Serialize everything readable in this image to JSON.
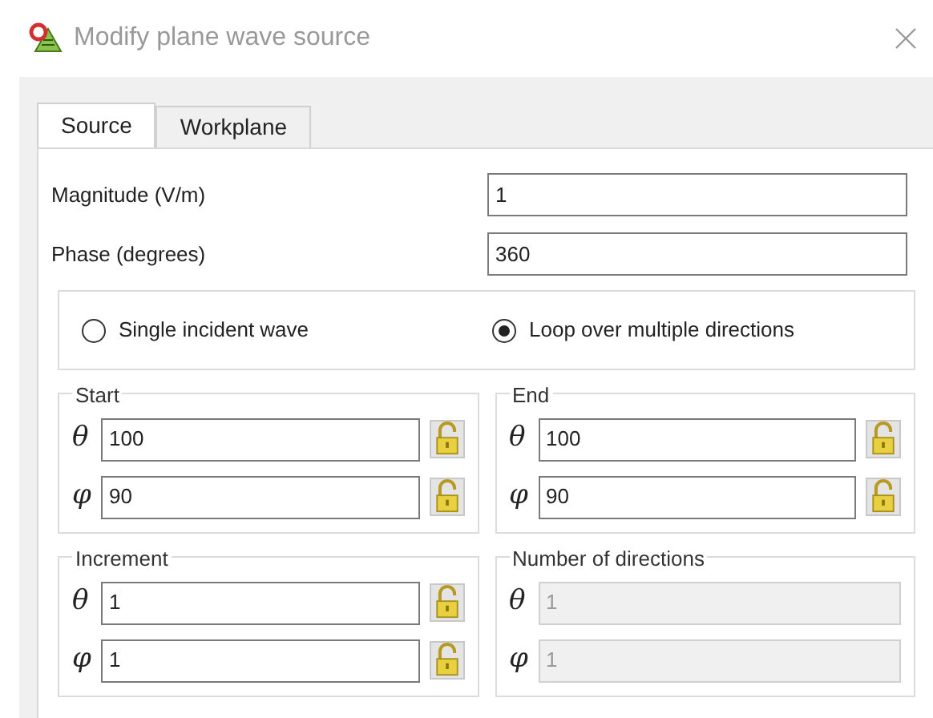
{
  "window": {
    "title": "Modify plane wave source"
  },
  "tabs": [
    {
      "label": "Source",
      "selected": true
    },
    {
      "label": "Workplane",
      "selected": false
    }
  ],
  "fields": [
    {
      "label": "Magnitude (V/m)",
      "value": "1"
    },
    {
      "label": "Phase (degrees)",
      "value": "360"
    }
  ],
  "mode": [
    {
      "label": "Single incident wave",
      "selected": false
    },
    {
      "label": "Loop over multiple directions",
      "selected": true
    }
  ],
  "groups": [
    {
      "title": "Start",
      "rows": [
        {
          "symbol": "θ",
          "value": "100",
          "disabled": false,
          "lock": true
        },
        {
          "symbol": "φ",
          "value": "90",
          "disabled": false,
          "lock": true
        }
      ]
    },
    {
      "title": "End",
      "rows": [
        {
          "symbol": "θ",
          "value": "100",
          "disabled": false,
          "lock": true
        },
        {
          "symbol": "φ",
          "value": "90",
          "disabled": false,
          "lock": true
        }
      ]
    },
    {
      "title": "Increment",
      "rows": [
        {
          "symbol": "θ",
          "value": "1",
          "disabled": false,
          "lock": true
        },
        {
          "symbol": "φ",
          "value": "1",
          "disabled": false,
          "lock": true
        }
      ]
    },
    {
      "title": "Number of directions",
      "rows": [
        {
          "symbol": "θ",
          "value": "1",
          "disabled": true,
          "lock": false
        },
        {
          "symbol": "φ",
          "value": "1",
          "disabled": true,
          "lock": false
        }
      ]
    }
  ]
}
